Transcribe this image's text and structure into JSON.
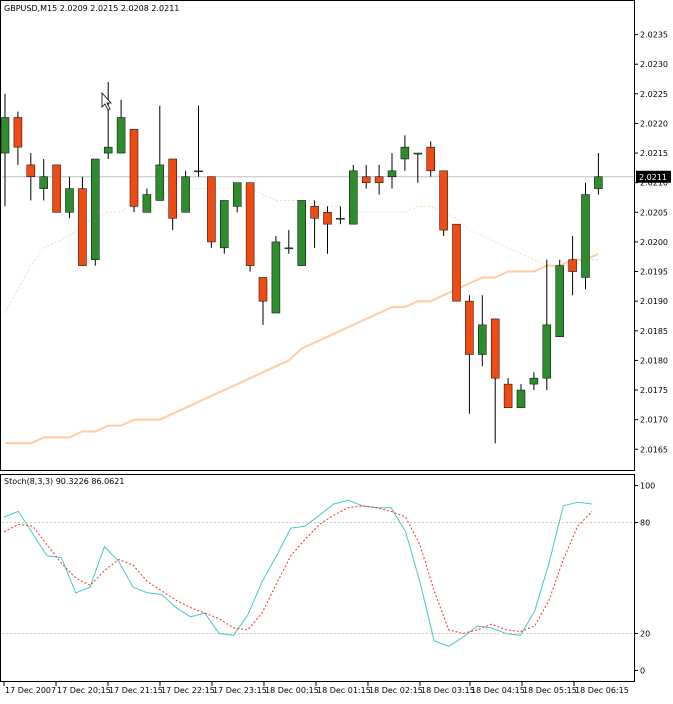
{
  "window": {
    "header": "GBPUSD,M15  2.0209 2.0215 2.0208 2.0211"
  },
  "colors": {
    "bull": "#2e8b2e",
    "bear": "#ef4b12",
    "candle_outline": "#000000",
    "ma_fast": "#ffd8b0",
    "ma_slow": "#ffcba4",
    "stoch_main": "#48c8c8",
    "stoch_signal": "#ff2a2a",
    "grid": "#c8c8c8",
    "frame": "#000000",
    "bid_line": "#c0c0c0",
    "price_tag_bg": "#000000",
    "price_tag_fg": "#ffffff"
  },
  "chart_data": [
    {
      "type": "candlestick",
      "symbol_header": "GBPUSD,M15  2.0209 2.0215 2.0208 2.0211",
      "current_price_tag": "2.0211",
      "y_ticks": [
        "2.0235",
        "2.0230",
        "2.0225",
        "2.0220",
        "2.0215",
        "2.0210",
        "2.0205",
        "2.0200",
        "2.0195",
        "2.0190",
        "2.0185",
        "2.0180",
        "2.0175",
        "2.0170",
        "2.0165"
      ],
      "y_tick_values": [
        2.0235,
        2.023,
        2.0225,
        2.022,
        2.0215,
        2.021,
        2.0205,
        2.02,
        2.0195,
        2.019,
        2.0185,
        2.018,
        2.0175,
        2.017,
        2.0165
      ],
      "ylim": [
        2.01615,
        2.02405
      ],
      "current_price": 2.0211,
      "candles": [
        {
          "o": 2.0215,
          "h": 2.0225,
          "l": 2.0206,
          "c": 2.0221
        },
        {
          "o": 2.0221,
          "h": 2.0222,
          "l": 2.0213,
          "c": 2.0216
        },
        {
          "o": 2.0213,
          "h": 2.0215,
          "l": 2.0207,
          "c": 2.0211
        },
        {
          "o": 2.0209,
          "h": 2.0214,
          "l": 2.0207,
          "c": 2.0211
        },
        {
          "o": 2.0213,
          "h": 2.0213,
          "l": 2.0205,
          "c": 2.0205
        },
        {
          "o": 2.0205,
          "h": 2.0211,
          "l": 2.0204,
          "c": 2.0209
        },
        {
          "o": 2.0209,
          "h": 2.0211,
          "l": 2.0196,
          "c": 2.0196
        },
        {
          "o": 2.0197,
          "h": 2.0213,
          "l": 2.0196,
          "c": 2.0214
        },
        {
          "o": 2.0215,
          "h": 2.0227,
          "l": 2.0214,
          "c": 2.0216
        },
        {
          "o": 2.0215,
          "h": 2.0224,
          "l": 2.0215,
          "c": 2.0221
        },
        {
          "o": 2.0219,
          "h": 2.0219,
          "l": 2.0205,
          "c": 2.0206
        },
        {
          "o": 2.0205,
          "h": 2.0209,
          "l": 2.0205,
          "c": 2.0208
        },
        {
          "o": 2.0207,
          "h": 2.0223,
          "l": 2.0207,
          "c": 2.0213
        },
        {
          "o": 2.0214,
          "h": 2.0214,
          "l": 2.0202,
          "c": 2.0204
        },
        {
          "o": 2.0205,
          "h": 2.0212,
          "l": 2.0205,
          "c": 2.0211
        },
        {
          "o": 2.0212,
          "h": 2.0223,
          "l": 2.0211,
          "c": 2.0212
        },
        {
          "o": 2.0211,
          "h": 2.0211,
          "l": 2.0199,
          "c": 2.02
        },
        {
          "o": 2.0199,
          "h": 2.0206,
          "l": 2.0198,
          "c": 2.0207
        },
        {
          "o": 2.0206,
          "h": 2.021,
          "l": 2.0205,
          "c": 2.021
        },
        {
          "o": 2.021,
          "h": 2.021,
          "l": 2.0195,
          "c": 2.0196
        },
        {
          "o": 2.0194,
          "h": 2.0194,
          "l": 2.0186,
          "c": 2.019
        },
        {
          "o": 2.0188,
          "h": 2.0201,
          "l": 2.0188,
          "c": 2.02
        },
        {
          "o": 2.0199,
          "h": 2.0202,
          "l": 2.0198,
          "c": 2.0199
        },
        {
          "o": 2.0196,
          "h": 2.0207,
          "l": 2.0196,
          "c": 2.0207
        },
        {
          "o": 2.0206,
          "h": 2.0207,
          "l": 2.0199,
          "c": 2.0204
        },
        {
          "o": 2.0205,
          "h": 2.0206,
          "l": 2.0198,
          "c": 2.0203
        },
        {
          "o": 2.0204,
          "h": 2.0206,
          "l": 2.0203,
          "c": 2.0204
        },
        {
          "o": 2.0203,
          "h": 2.0213,
          "l": 2.0203,
          "c": 2.0212
        },
        {
          "o": 2.0211,
          "h": 2.0213,
          "l": 2.0209,
          "c": 2.021
        },
        {
          "o": 2.0211,
          "h": 2.0213,
          "l": 2.0208,
          "c": 2.021
        },
        {
          "o": 2.0211,
          "h": 2.0215,
          "l": 2.0209,
          "c": 2.0212
        },
        {
          "o": 2.0214,
          "h": 2.0218,
          "l": 2.0212,
          "c": 2.0216
        },
        {
          "o": 2.0215,
          "h": 2.0215,
          "l": 2.021,
          "c": 2.0215
        },
        {
          "o": 2.0216,
          "h": 2.0217,
          "l": 2.0211,
          "c": 2.0212
        },
        {
          "o": 2.0212,
          "h": 2.0212,
          "l": 2.0201,
          "c": 2.0202
        },
        {
          "o": 2.0203,
          "h": 2.0203,
          "l": 2.019,
          "c": 2.019
        },
        {
          "o": 2.019,
          "h": 2.0191,
          "l": 2.0171,
          "c": 2.0181
        },
        {
          "o": 2.0181,
          "h": 2.0191,
          "l": 2.0179,
          "c": 2.0186
        },
        {
          "o": 2.0187,
          "h": 2.0187,
          "l": 2.0166,
          "c": 2.0177
        },
        {
          "o": 2.0176,
          "h": 2.0177,
          "l": 2.0173,
          "c": 2.0172
        },
        {
          "o": 2.0172,
          "h": 2.0176,
          "l": 2.0172,
          "c": 2.0175
        },
        {
          "o": 2.0176,
          "h": 2.0178,
          "l": 2.0175,
          "c": 2.0177
        },
        {
          "o": 2.0177,
          "h": 2.0197,
          "l": 2.0175,
          "c": 2.0186
        },
        {
          "o": 2.0184,
          "h": 2.0197,
          "l": 2.0184,
          "c": 2.0196
        },
        {
          "o": 2.0197,
          "h": 2.0201,
          "l": 2.0191,
          "c": 2.0195
        },
        {
          "o": 2.0194,
          "h": 2.021,
          "l": 2.0192,
          "c": 2.0208
        },
        {
          "o": 2.0209,
          "h": 2.0215,
          "l": 2.0208,
          "c": 2.0211
        }
      ],
      "ma_fast": [
        2.0188,
        2.0192,
        2.0196,
        2.0199,
        2.02,
        2.0201,
        2.0203,
        2.0204,
        2.0205,
        2.0205,
        2.0207,
        2.0208,
        2.0208,
        2.0209,
        2.0209,
        2.0209,
        2.0209,
        2.0209,
        2.0209,
        2.0209,
        2.0208,
        2.0207,
        2.0207,
        2.0207,
        2.0207,
        2.0206,
        2.0206,
        2.0205,
        2.0205,
        2.0205,
        2.0205,
        2.0205,
        2.0206,
        2.0206,
        2.0205,
        2.0204,
        2.0202,
        2.0201,
        2.02,
        2.0199,
        2.0198,
        2.0197,
        2.0196,
        2.0196,
        2.0196,
        2.0197,
        2.0197
      ],
      "ma_slow": [
        2.0166,
        2.0166,
        2.0166,
        2.0167,
        2.0167,
        2.0167,
        2.0168,
        2.0168,
        2.0169,
        2.0169,
        2.017,
        2.017,
        2.017,
        2.0171,
        2.0172,
        2.0173,
        2.0174,
        2.0175,
        2.0176,
        2.0177,
        2.0178,
        2.0179,
        2.018,
        2.0182,
        2.0183,
        2.0184,
        2.0185,
        2.0186,
        2.0187,
        2.0188,
        2.0189,
        2.0189,
        2.019,
        2.019,
        2.0191,
        2.0192,
        2.0193,
        2.0194,
        2.0194,
        2.0195,
        2.0195,
        2.0195,
        2.0196,
        2.0196,
        2.0197,
        2.0197,
        2.0198
      ]
    },
    {
      "type": "line",
      "label": "Stoch(8,3,3) 90.3226 86.0621",
      "y_ticks": [
        "100",
        "80",
        "20",
        "0"
      ],
      "y_tick_values": [
        100,
        80,
        20,
        0
      ],
      "levels": [
        80,
        20
      ],
      "ylim": [
        -3,
        103
      ],
      "series": [
        {
          "name": "main",
          "values": [
            83,
            86,
            74,
            62,
            61,
            42,
            45,
            67,
            59,
            45,
            42,
            41,
            34,
            29,
            31,
            20,
            19,
            30,
            48,
            62,
            77,
            78,
            84,
            90,
            92,
            89,
            88,
            88,
            75,
            48,
            16,
            13,
            18,
            24,
            23,
            20,
            19,
            32,
            58,
            89,
            91,
            90
          ]
        },
        {
          "name": "signal",
          "values": [
            75,
            79,
            78,
            68,
            58,
            50,
            46,
            54,
            60,
            57,
            48,
            43,
            38,
            34,
            31,
            28,
            23,
            22,
            31,
            47,
            62,
            71,
            79,
            84,
            88,
            89,
            88,
            86,
            83,
            68,
            43,
            22,
            20,
            22,
            25,
            22,
            21,
            24,
            38,
            60,
            78,
            86
          ]
        }
      ],
      "x_ticks": [
        "17 Dec 2007",
        "17 Dec 20:15",
        "17 Dec 21:15",
        "17 Dec 22:15",
        "17 Dec 23:15",
        "18 Dec 00:15",
        "18 Dec 01:15",
        "18 Dec 02:15",
        "18 Dec 03:15",
        "18 Dec 04:15",
        "18 Dec 05:15",
        "18 Dec 06:15"
      ]
    }
  ]
}
